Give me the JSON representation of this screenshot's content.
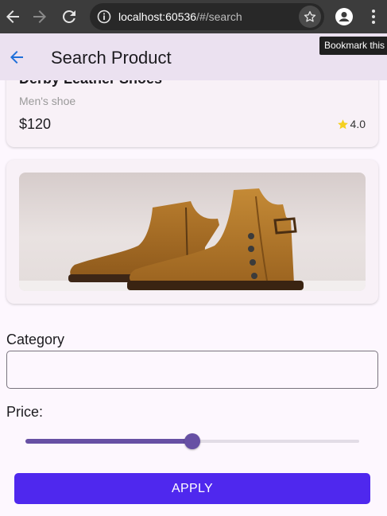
{
  "browser": {
    "url_host": "localhost:60536",
    "url_path": "/#/search",
    "bookmark_tooltip": "Bookmark this"
  },
  "appbar": {
    "title": "Search Product"
  },
  "product": {
    "name": "Derby Leather Shoes",
    "category": "Men's shoe",
    "price": "$120",
    "rating": "4.0"
  },
  "filters": {
    "category_label": "Category",
    "category_value": "",
    "price_label": "Price:",
    "price_slider_fraction": 0.5
  },
  "apply_label": "APPLY",
  "colors": {
    "accent": "#6750a4",
    "apply_button": "#4f28ee",
    "star": "#f5d020",
    "back_arrow": "#1e6fd9"
  }
}
